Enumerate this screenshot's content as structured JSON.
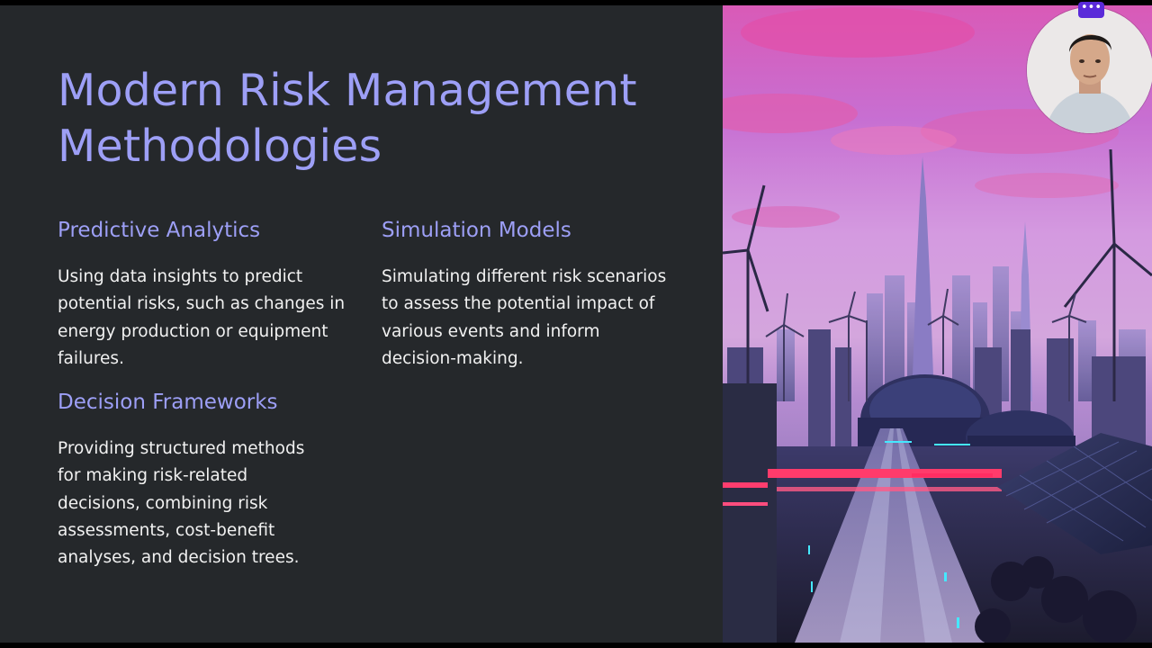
{
  "slide": {
    "title": "Modern Risk Management\nMethodologies",
    "sections": [
      {
        "heading": "Predictive Analytics",
        "body": "Using data insights to predict potential risks, such as changes in energy production or equipment failures."
      },
      {
        "heading": "Simulation Models",
        "body": "Simulating different risk scenarios to assess the potential impact of various events and inform decision-making."
      },
      {
        "heading": "Decision Frameworks",
        "body": "Providing structured methods for making risk-related decisions, combining risk assessments, cost-benefit analyses, and decision trees."
      }
    ],
    "image_description": "futuristic-city-wind-turbines-solar-panels"
  },
  "webcam": {
    "more_button": "•••",
    "icon": "more-options-icon"
  },
  "colors": {
    "heading": "#9d9ff6",
    "body_text": "#f1f1f1",
    "background": "#25282b",
    "accent_button": "#5a2ad9"
  }
}
